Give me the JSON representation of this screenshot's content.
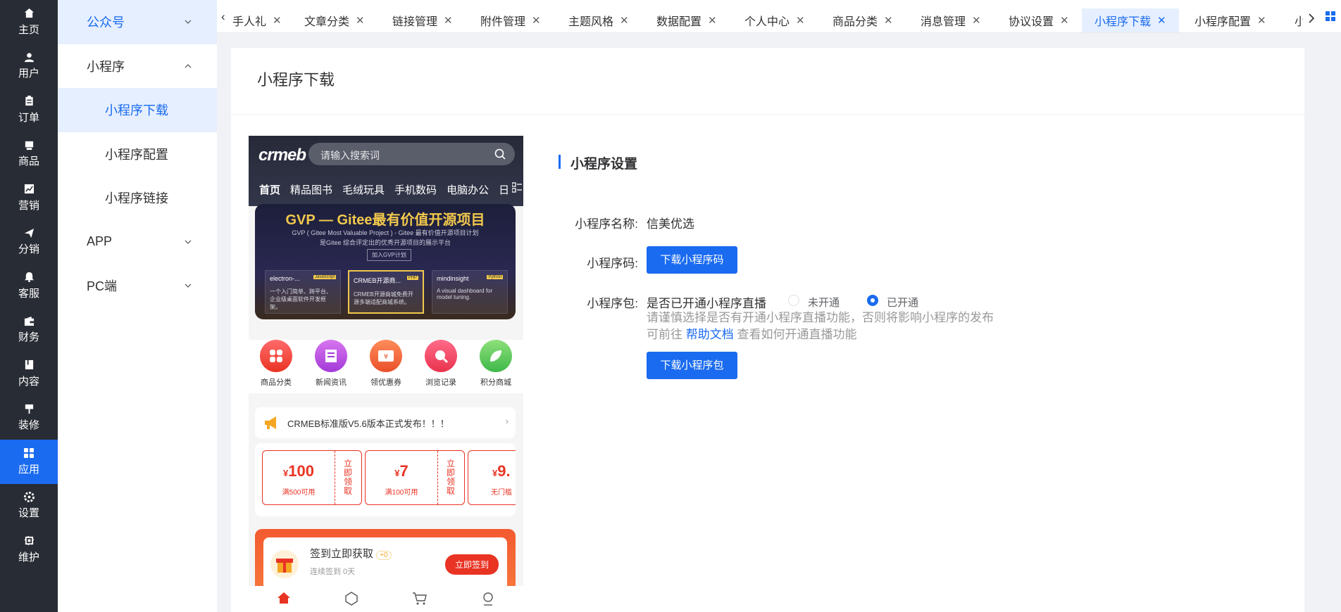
{
  "rail": [
    {
      "label": "主页",
      "icon": "home-icon"
    },
    {
      "label": "用户",
      "icon": "user-icon"
    },
    {
      "label": "订单",
      "icon": "order-icon"
    },
    {
      "label": "商品",
      "icon": "product-icon"
    },
    {
      "label": "营销",
      "icon": "marketing-icon"
    },
    {
      "label": "分销",
      "icon": "distribution-icon"
    },
    {
      "label": "客服",
      "icon": "customer-service-icon"
    },
    {
      "label": "财务",
      "icon": "finance-icon"
    },
    {
      "label": "内容",
      "icon": "content-icon"
    },
    {
      "label": "装修",
      "icon": "decoration-icon"
    },
    {
      "label": "应用",
      "icon": "apps-icon"
    },
    {
      "label": "设置",
      "icon": "settings-icon"
    },
    {
      "label": "维护",
      "icon": "maintenance-icon"
    }
  ],
  "submenu": {
    "gzh": "公众号",
    "mini": "小程序",
    "mini_children": [
      "小程序下载",
      "小程序配置",
      "小程序链接"
    ],
    "app": "APP",
    "pc": "PC端"
  },
  "tabs": [
    "手人礼",
    "文章分类",
    "链接管理",
    "附件管理",
    "主题风格",
    "数据配置",
    "个人中心",
    "商品分类",
    "消息管理",
    "协议设置",
    "小程序下载",
    "小程序配置",
    "小"
  ],
  "page_title": "小程序下载",
  "phone": {
    "logo": "crmeb",
    "search_placeholder": "请输入搜索词",
    "cats": [
      "首页",
      "精品图书",
      "毛绒玩具",
      "手机数码",
      "电脑办公",
      "日"
    ],
    "banner_title": "GVP — Gitee最有价值开源项目",
    "banner_sub1": "GVP ( Gitee Most Valuable Project ) - Gitee 最有价值开源项目计划",
    "banner_sub2": "是Gitee 综合评定出的优秀开源项目的展示平台",
    "banner_btn": "加入GVP计划",
    "banner_cards": [
      {
        "name": "electron-...",
        "tag": "JavaScript",
        "desc": "一个入门简单、跨平台、企业级桌面软件开发框架。"
      },
      {
        "name": "CRMEB开源商...",
        "tag": "PHP",
        "desc": "CRMEB开源商城免费开源多端适配商城系统。"
      },
      {
        "name": "mindinsight",
        "tag": "Python",
        "desc": "A visual dashboard for model tuning."
      }
    ],
    "icons": [
      "商品分类",
      "新闻资讯",
      "领优惠券",
      "浏览记录",
      "积分商城"
    ],
    "notice": "CRMEB标准版V5.6版本正式发布！！！",
    "coupons": [
      {
        "amount": "100",
        "cond": "满500可用",
        "get": "立即领取"
      },
      {
        "amount": "7",
        "cond": "满100可用",
        "get": "立即领取"
      },
      {
        "amount": "9.",
        "cond": "无门槛"
      }
    ],
    "signin_title": "签到立即获取",
    "signin_badge": "+0",
    "signin_days": "连续签到 0天",
    "signin_btn": "立即签到"
  },
  "settings": {
    "section_title": "小程序设置",
    "name_label": "小程序名称:",
    "name_value": "信美优选",
    "code_label": "小程序码:",
    "code_btn": "下载小程序码",
    "pkg_label": "小程序包:",
    "live_question": "是否已开通小程序直播",
    "opt_off": "未开通",
    "opt_on": "已开通",
    "live_enabled": true,
    "hint_part1": "请谨慎选择是否有开通小程序直播功能，否则将影响小程序的发布 可前往",
    "hint_link": "帮助文档",
    "hint_part2": "查看如何开通直播功能",
    "pkg_btn": "下载小程序包"
  }
}
